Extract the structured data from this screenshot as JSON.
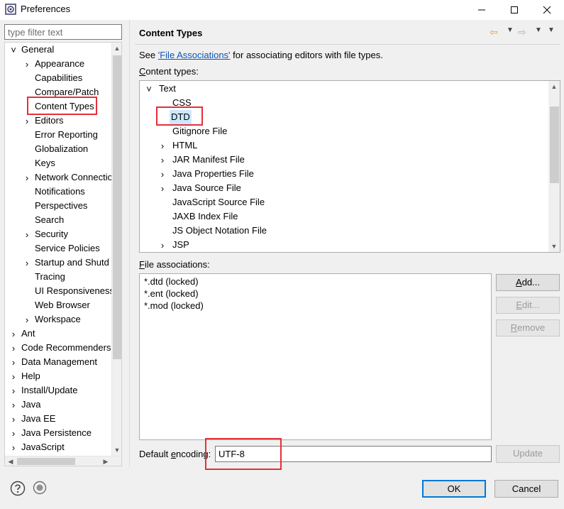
{
  "window": {
    "title": "Preferences",
    "minimize_label": "—",
    "maximize_label": "☐",
    "close_label": "✕"
  },
  "filter": {
    "placeholder": "type filter text"
  },
  "tree": {
    "items": [
      {
        "label": "General",
        "chevron": "˅"
      },
      {
        "label": "Appearance",
        "chevron": "›"
      },
      {
        "label": "Capabilities",
        "chevron": ""
      },
      {
        "label": "Compare/Patch",
        "chevron": ""
      },
      {
        "label": "Content Types",
        "chevron": ""
      },
      {
        "label": "Editors",
        "chevron": "›"
      },
      {
        "label": "Error Reporting",
        "chevron": ""
      },
      {
        "label": "Globalization",
        "chevron": ""
      },
      {
        "label": "Keys",
        "chevron": ""
      },
      {
        "label": "Network Connectio",
        "chevron": "›"
      },
      {
        "label": "Notifications",
        "chevron": ""
      },
      {
        "label": "Perspectives",
        "chevron": ""
      },
      {
        "label": "Search",
        "chevron": ""
      },
      {
        "label": "Security",
        "chevron": "›"
      },
      {
        "label": "Service Policies",
        "chevron": ""
      },
      {
        "label": "Startup and Shutd",
        "chevron": "›"
      },
      {
        "label": "Tracing",
        "chevron": ""
      },
      {
        "label": "UI Responsiveness",
        "chevron": ""
      },
      {
        "label": "Web Browser",
        "chevron": ""
      },
      {
        "label": "Workspace",
        "chevron": "›"
      },
      {
        "label": "Ant",
        "chevron": "›"
      },
      {
        "label": "Code Recommenders",
        "chevron": "›"
      },
      {
        "label": "Data Management",
        "chevron": "›"
      },
      {
        "label": "Help",
        "chevron": "›"
      },
      {
        "label": "Install/Update",
        "chevron": "›"
      },
      {
        "label": "Java",
        "chevron": "›"
      },
      {
        "label": "Java EE",
        "chevron": "›"
      },
      {
        "label": "Java Persistence",
        "chevron": "›"
      },
      {
        "label": "JavaScript",
        "chevron": "›"
      }
    ],
    "scroll_up": "▲",
    "scroll_down": "▼",
    "scroll_left": "◀",
    "scroll_right": "▶"
  },
  "right": {
    "title": "Content Types",
    "nav_back": "⇦",
    "nav_fwd": "⇨",
    "dropdown": "▼",
    "see_prefix": "See ",
    "see_link": "'File Associations'",
    "see_suffix": " for associating editors with file types.",
    "content_types_label_mn": "C",
    "content_types_label_rest": "ontent types:",
    "content_types": [
      {
        "label": "Text",
        "chevron": "˅"
      },
      {
        "label": "CSS",
        "chevron": ""
      },
      {
        "label": "DTD",
        "chevron": ""
      },
      {
        "label": "Gitignore File",
        "chevron": ""
      },
      {
        "label": "HTML",
        "chevron": "›"
      },
      {
        "label": "JAR Manifest File",
        "chevron": "›"
      },
      {
        "label": "Java Properties File",
        "chevron": "›"
      },
      {
        "label": "Java Source File",
        "chevron": "›"
      },
      {
        "label": "JavaScript Source File",
        "chevron": ""
      },
      {
        "label": "JAXB Index File",
        "chevron": ""
      },
      {
        "label": "JS Object Notation File",
        "chevron": ""
      },
      {
        "label": "JSP",
        "chevron": "›"
      }
    ],
    "file_assoc_label_mn": "F",
    "file_assoc_label_rest": "ile associations:",
    "file_associations": [
      "*.dtd (locked)",
      "*.ent (locked)",
      "*.mod (locked)"
    ],
    "add_mn": "A",
    "add_rest": "dd...",
    "edit_mn": "E",
    "edit_rest": "dit...",
    "remove_mn": "R",
    "remove_rest": "emove",
    "encoding_label_pre": "Default ",
    "encoding_label_mn": "e",
    "encoding_label_post": "ncoding:",
    "encoding_value": "UTF-8",
    "update_label": "Update"
  },
  "bottom": {
    "ok_label": "OK",
    "cancel_label": "Cancel"
  },
  "colors": {
    "highlight_box": "#e5303a",
    "link": "#0a55b5",
    "selection": "#cce8ff",
    "default_button_border": "#0078d7"
  }
}
